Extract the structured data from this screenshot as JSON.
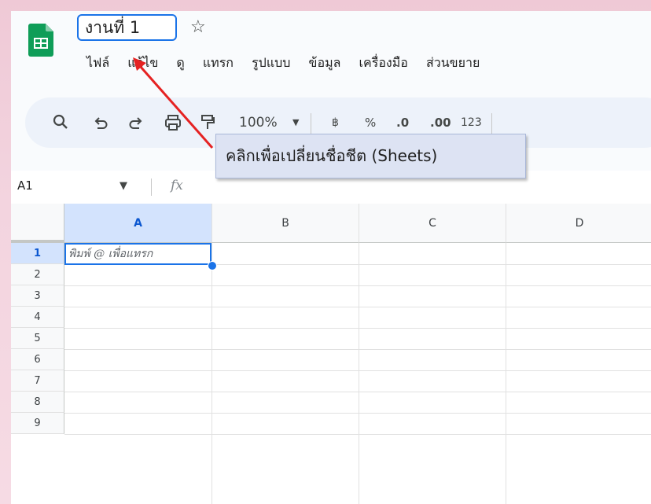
{
  "document": {
    "title": "งานที่ 1",
    "star_icon": "star-outline-icon"
  },
  "menu": [
    "ไฟล์",
    "แก้ไข",
    "ดู",
    "แทรก",
    "รูปแบบ",
    "ข้อมูล",
    "เครื่องมือ",
    "ส่วนขยาย"
  ],
  "toolbar": {
    "search_icon": "🔍",
    "undo_icon": "↶",
    "redo_icon": "↷",
    "print_icon": "print-icon",
    "paint_format_icon": "paint-format-icon",
    "zoom": "100%",
    "currency": "฿",
    "percent": "%",
    "decrease_decimal": ".0",
    "increase_decimal": ".00",
    "number_format": "123"
  },
  "formula_bar": {
    "name_box": "A1",
    "fx_label": "fx"
  },
  "grid": {
    "columns": [
      "A",
      "B",
      "C",
      "D"
    ],
    "rows": [
      "1",
      "2",
      "3",
      "4",
      "5",
      "6",
      "7",
      "8",
      "9"
    ],
    "active_cell_placeholder": "พิมพ์ @ เพื่อแทรก"
  },
  "annotation": {
    "text": "คลิกเพื่อเปลี่ยนชื่อชีต (Sheets)",
    "arrow_color": "#e52222"
  },
  "colors": {
    "accent": "#1a73e8",
    "sheets_green": "#0f9d58",
    "selected_header": "#d3e3fd"
  }
}
